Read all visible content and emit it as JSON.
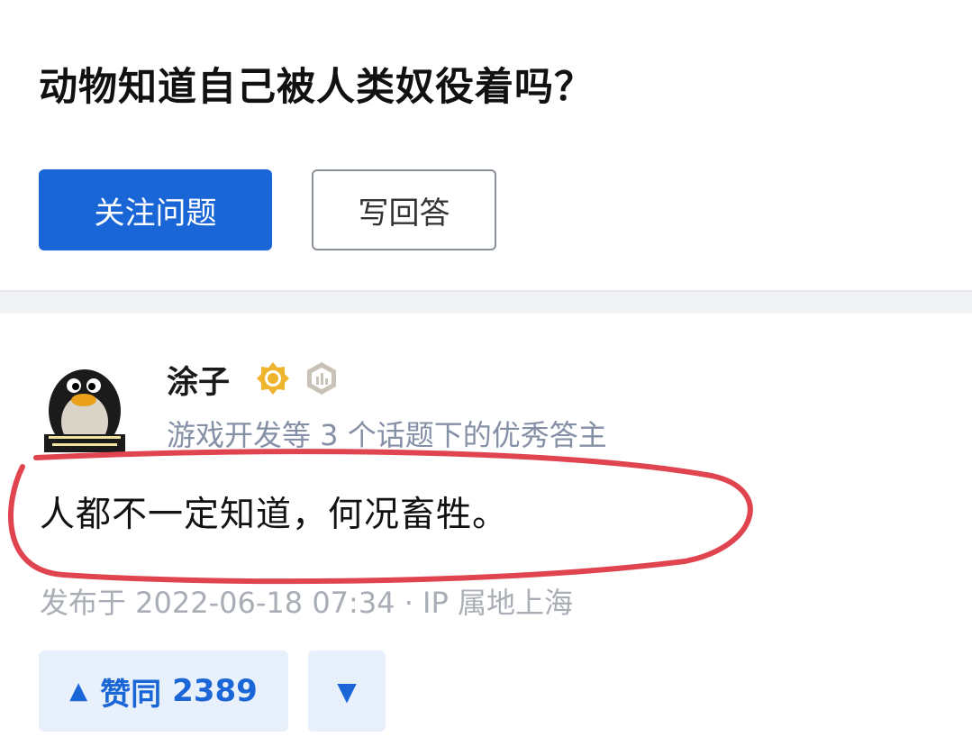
{
  "question": {
    "title": "动物知道自己被人类奴役着吗？",
    "follow_button": "关注问题",
    "answer_button": "写回答"
  },
  "answer": {
    "author_name": "涂子",
    "author_desc": "游戏开发等 3 个话题下的优秀答主",
    "content": "人都不一定知道，何况畜牲。",
    "meta": "发布于 2022-06-18 07:34 · IP 属地上海",
    "avatar_icon": "penguin-avatar-icon",
    "badges": [
      "gold-badge-icon",
      "gray-badge-icon"
    ],
    "highlight_color": "#e0454f"
  },
  "actions": {
    "upvote_icon": "▲",
    "upvote_label": "赞同",
    "upvote_count": "2389",
    "downvote_icon": "▼"
  },
  "colors": {
    "accent": "#1a66d6",
    "muted_text": "#8590a6",
    "vote_bg": "#e8f0fb"
  }
}
